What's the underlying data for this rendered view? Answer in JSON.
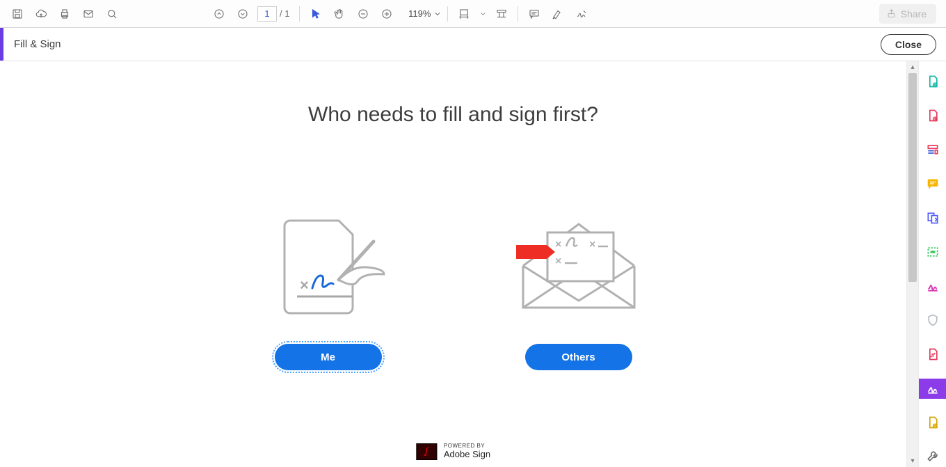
{
  "toolbar": {
    "page_current": "1",
    "page_total": "/ 1",
    "zoom_value": "119%",
    "share_label": "Share"
  },
  "subheader": {
    "title": "Fill & Sign",
    "close_label": "Close"
  },
  "main": {
    "question": "Who needs to fill and sign first?",
    "option_me": "Me",
    "option_others": "Others",
    "powered_small": "POWERED BY",
    "powered_brand": "Adobe Sign"
  },
  "icons": {
    "save": "save-icon",
    "cloud": "cloud-upload-icon",
    "print": "print-icon",
    "mail": "mail-icon",
    "find": "search-icon",
    "page_up": "page-up-icon",
    "page_down": "page-down-icon",
    "selection": "selection-arrow-icon",
    "hand": "hand-tool-icon",
    "zoom_out": "zoom-out-icon",
    "zoom_in": "zoom-in-icon",
    "fit_width": "fit-width-icon",
    "read_mode": "read-mode-icon",
    "comment": "comment-icon",
    "highlight": "highlighter-icon",
    "sign": "signature-icon"
  },
  "right_rail": {
    "items": [
      {
        "name": "create-pdf-icon",
        "color": "#0fb5a5"
      },
      {
        "name": "export-pdf-icon",
        "color": "#e8395d"
      },
      {
        "name": "edit-pdf-icon",
        "color": "#e8395d"
      },
      {
        "name": "comment-pdf-icon",
        "color": "#f7b500"
      },
      {
        "name": "organize-pages-icon",
        "color": "#4b59ff"
      },
      {
        "name": "redact-icon",
        "color": "#34c759"
      },
      {
        "name": "sign-tool-icon",
        "color": "#d62fb1"
      },
      {
        "name": "protect-icon",
        "color": "#9aa0a6"
      },
      {
        "name": "compress-icon",
        "color": "#e8395d"
      },
      {
        "name": "fill-sign-icon",
        "color": "#8c3be8",
        "active": true
      },
      {
        "name": "send-for-comment-icon",
        "color": "#d6a300"
      },
      {
        "name": "more-tools-icon",
        "color": "#6f6f6f"
      }
    ]
  }
}
